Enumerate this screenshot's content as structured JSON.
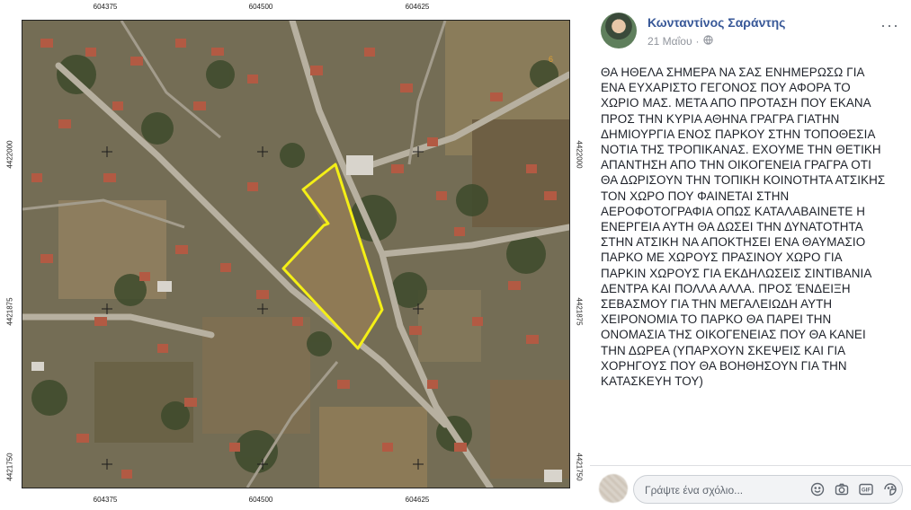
{
  "map": {
    "x_ticks": [
      "604375",
      "604500",
      "604625"
    ],
    "y_ticks": [
      "4422000",
      "4421875",
      "4421750"
    ],
    "corner_mark": "6"
  },
  "post": {
    "author": "Κωνταντίνος Σαράντης",
    "date": "21 Μαΐου",
    "privacy_icon": "globe-icon",
    "more_icon": "more-dots-icon",
    "more_label": "···",
    "body": "ΘΑ ΗΘΕΛΑ ΣΗΜΕΡΑ ΝΑ ΣΑΣ ΕΝΗΜΕΡΩΣΩ ΓΙΑ ΕΝΑ ΕΥΧΑΡΙΣΤΟ ΓΕΓΟΝΟΣ ΠΟΥ ΑΦΟΡΑ ΤΟ ΧΩΡΙΟ ΜΑΣ. ΜΕΤΑ ΑΠΟ ΠΡΟΤΑΣΗ ΠΟΥ ΕΚΑΝΑ ΠΡΟΣ ΤΗΝ ΚΥΡΙΑ ΑΘΗΝΑ ΓΡΑΓΡΑ ΓΙΑΤΗΝ ΔΗΜΙΟΥΡΓΙΑ ΕΝΟΣ ΠΑΡΚΟΥ ΣΤΗΝ ΤΟΠΟΘΕΣΙΑ ΝΟΤΙΑ ΤΗΣ ΤΡΟΠΙΚΑΝΑΣ. ΕΧΟΥΜΕ ΤΗΝ ΘΕΤΙΚΗ ΑΠΑΝΤΗΣΗ ΑΠΟ ΤΗΝ ΟΙΚΟΓΕΝΕΙΑ ΓΡΑΓΡΑ ΟΤΙ ΘΑ ΔΩΡΙΣΟΥΝ ΤΗΝ ΤΟΠΙΚΗ ΚΟΙΝΟΤΗΤΑ ΑΤΣΙΚΗΣ ΤΟΝ ΧΩΡΟ ΠΟΥ ΦΑΙΝΕΤΑΙ ΣΤΗΝ ΑΕΡΟΦΟΤΟΓΡΑΦΙΑ ΟΠΩΣ ΚΑΤΑΛΑΒΑΙΝΕΤΕ Η ΕΝΕΡΓΕΙΑ ΑΥΤΗ ΘΑ ΔΩΣΕΙ ΤΗΝ ΔΥΝΑΤΟΤΗΤΑ ΣΤΗΝ ΑΤΣΙΚΗ ΝΑ ΑΠΟΚΤΗΣΕΙ ΕΝΑ ΘΑΥΜΑΣΙΟ ΠΑΡΚΟ ΜΕ ΧΩΡΟΥΣ ΠΡΑΣΙΝΟΥ ΧΩΡΟ ΓΙΑ ΠΑΡΚΙΝ ΧΩΡΟΥΣ ΓΙΑ ΕΚΔΗΛΩΣΕΙΣ ΣΙΝΤΙΒΑΝΙΑ ΔΕΝΤΡΑ ΚΑΙ ΠΟΛΛΑ ΑΛΛΑ. ΠΡΟΣ ΈΝΔΕΙΞΗ ΣΕΒΑΣΜΟΥ ΓΙΑ ΤΗΝ ΜΕΓΑΛΕΙΩΔΗ ΑΥΤΗ ΧΕΙΡΟΝΟΜΙΑ ΤΟ ΠΑΡΚΟ ΘΑ ΠΑΡΕΙ ΤΗΝ ΟΝΟΜΑΣΙΑ ΤΗΣ ΟΙΚΟΓΕΝΕΙΑΣ ΠΟΥ ΘΑ ΚΑΝΕΙ ΤΗΝ ΔΩΡΕΑ (ΥΠΑΡΧΟΥΝ ΣΚΕΨΕΙΣ ΚΑΙ ΓΙΑ ΧΟΡΗΓΟΥΣ ΠΟΥ ΘΑ ΒΟΗΘΗΣΟΥΝ ΓΙΑ ΤΗΝ ΚΑΤΑΣΚΕΥΗ ΤΟΥ)"
  },
  "comment": {
    "placeholder": "Γράψτε ένα σχόλιο...",
    "icons": [
      "emoji-icon",
      "camera-icon",
      "gif-icon",
      "sticker-icon"
    ],
    "gif_label": "GIF"
  }
}
